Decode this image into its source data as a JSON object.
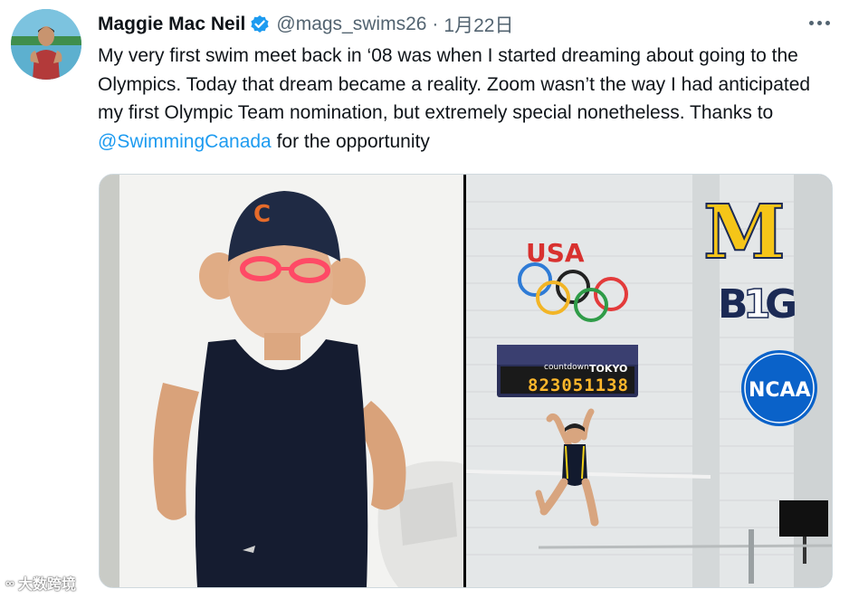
{
  "tweet": {
    "author_name": "Maggie Mac Neil",
    "handle": "@mags_swims26",
    "separator": "·",
    "date": "1月22日",
    "text_part1": "My very first swim meet back in ‘08 was when I started dreaming about going to the Olympics. Today that dream became a reality. Zoom wasn’t the way I had anticipated my first Olympic Team nomination, but extremely special nonetheless. Thanks to ",
    "mention": "@SwimmingCanada",
    "text_part2": " for the opportunity"
  },
  "icons": {
    "verified": "verified-badge-icon",
    "more": "more-options-icon"
  },
  "media": {
    "right_photo": {
      "usa_text": "USA",
      "clock_label": "countdown",
      "clock_city": "TOKYO",
      "clock_digits": "823051138",
      "m_logo": "M",
      "big_logo": "BIG",
      "ncaa_logo": "NCAA"
    }
  },
  "watermark": {
    "text": "大数跨境"
  },
  "colors": {
    "link": "#1d9bf0",
    "secondary_text": "#536471",
    "verified": "#1d9bf0"
  }
}
